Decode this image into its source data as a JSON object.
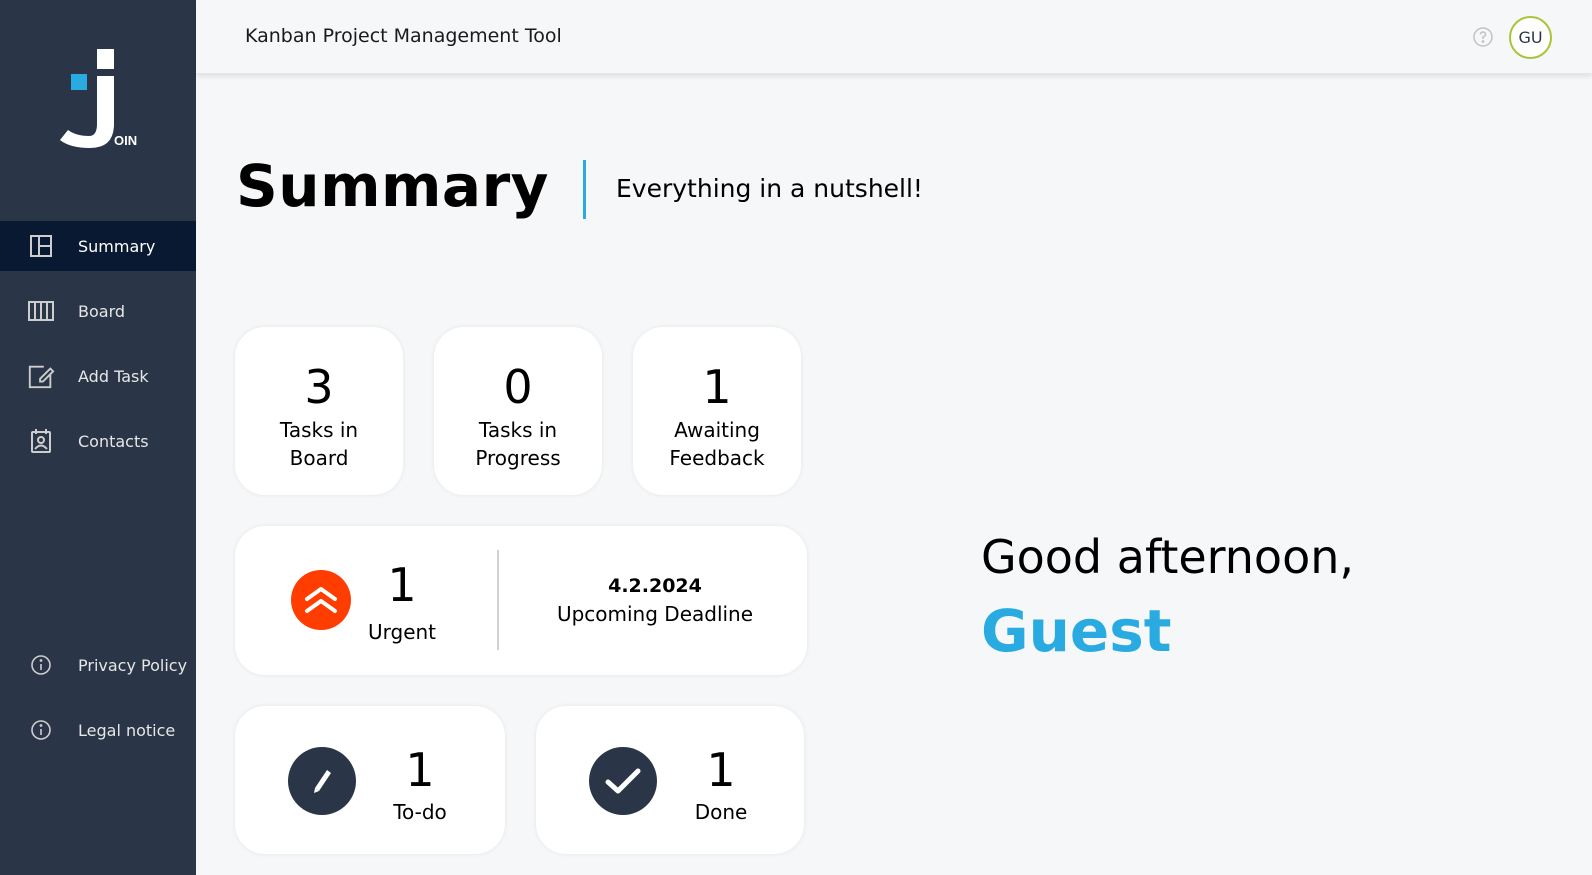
{
  "app": {
    "logo_text": "JOIN",
    "header_title": "Kanban Project Management Tool",
    "avatar_initials": "GU"
  },
  "sidebar": {
    "items": [
      {
        "label": "Summary",
        "icon": "summary-icon",
        "active": true
      },
      {
        "label": "Board",
        "icon": "board-icon",
        "active": false
      },
      {
        "label": "Add Task",
        "icon": "add-task-icon",
        "active": false
      },
      {
        "label": "Contacts",
        "icon": "contacts-icon",
        "active": false
      }
    ],
    "footer_items": [
      {
        "label": "Privacy Policy",
        "icon": "info-icon"
      },
      {
        "label": "Legal notice",
        "icon": "info-icon"
      }
    ]
  },
  "page": {
    "title": "Summary",
    "subtitle": "Everything in a nutshell!"
  },
  "metrics": {
    "tasks_in_board": {
      "value": "3",
      "label_line1": "Tasks in",
      "label_line2": "Board"
    },
    "tasks_in_progress": {
      "value": "0",
      "label_line1": "Tasks in",
      "label_line2": "Progress"
    },
    "awaiting_feedback": {
      "value": "1",
      "label_line1": "Awaiting",
      "label_line2": "Feedback"
    },
    "urgent": {
      "value": "1",
      "label": "Urgent"
    },
    "deadline": {
      "date": "4.2.2024",
      "label": "Upcoming Deadline"
    },
    "todo": {
      "value": "1",
      "label": "To-do"
    },
    "done": {
      "value": "1",
      "label": "Done"
    }
  },
  "greeting": {
    "text": "Good afternoon,",
    "name": "Guest"
  },
  "colors": {
    "sidebar_bg": "#2a3647",
    "sidebar_active": "#091931",
    "accent_blue": "#29abe2",
    "urgent_red": "#ff3d00",
    "avatar_border": "#a8c43a"
  }
}
